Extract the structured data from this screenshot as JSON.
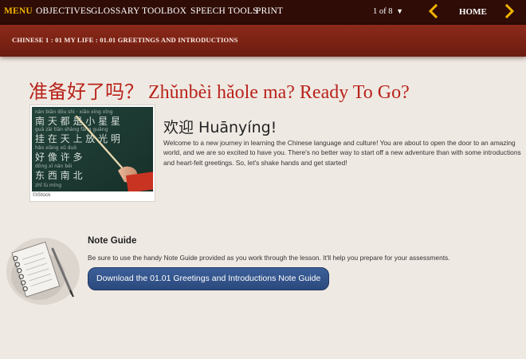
{
  "nav": {
    "menu_label": "MENU",
    "items": [
      {
        "label": "OBJECTIVES"
      },
      {
        "label": "GLOSSARY"
      },
      {
        "label": "TOOLBOX"
      },
      {
        "label": "SPEECH TOOLS"
      },
      {
        "label": "PRINT"
      }
    ],
    "page_indicator": "1 of 8",
    "page_caret": "▼",
    "home_label": "HOME",
    "prev_icon": "chevron-left-icon",
    "next_icon": "chevron-right-icon"
  },
  "breadcrumb": "CHINESE 1 : 01 MY LIFE : 01.01 GREETINGS AND INTRODUCTIONS",
  "page_title": "准备好了吗？ Zhǔnbèi hǎole ma? Ready To Go?",
  "photo": {
    "credit": "©iStock",
    "board_characters": [
      "小",
      "星",
      "星",
      "挂",
      "在",
      "天",
      "上",
      "放",
      "光",
      "明",
      "好",
      "像",
      "许",
      "多"
    ]
  },
  "welcome": {
    "heading": "欢迎 Huānyíng!",
    "body": "Welcome to a new journey in learning the Chinese language and culture! You are about to open the door to an amazing world, and we are so excited to have you. There's no better way to start off a new adventure than with some introductions and heart-felt greetings. So, let's shake hands and get started!"
  },
  "note_guide": {
    "heading": "Note Guide",
    "body": "Be sure to use the handy Note Guide provided as you work through the lesson. It'll help you prepare for your assessments.",
    "button_label": "Download the 01.01 Greetings and Introductions Note Guide"
  },
  "colors": {
    "nav_bg": "#2f0c06",
    "menu_accent": "#f0b400",
    "banner": "#7a2214",
    "title_red": "#b8231a",
    "button_blue": "#2f4f85"
  }
}
